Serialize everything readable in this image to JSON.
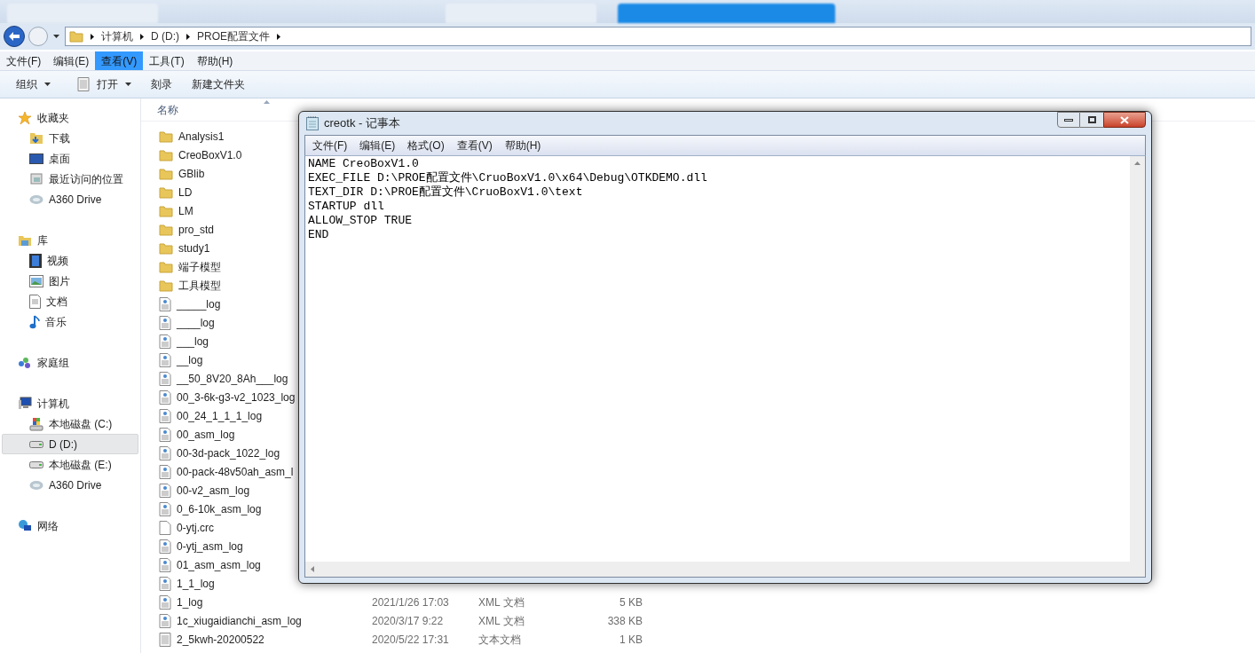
{
  "browser_tabs": [
    {
      "selected": false
    },
    {
      "selected": false
    },
    {
      "selected": true
    }
  ],
  "address_bar": {
    "crumbs": [
      "计算机",
      "D (D:)",
      "PROE配置文件"
    ]
  },
  "menu_bar": [
    {
      "label": "文件(F)",
      "selected": false
    },
    {
      "label": "编辑(E)",
      "selected": false
    },
    {
      "label": "查看(V)",
      "selected": true
    },
    {
      "label": "工具(T)",
      "selected": false
    },
    {
      "label": "帮助(H)",
      "selected": false
    }
  ],
  "toolbar": [
    {
      "label": "组织",
      "kind": "dropdown"
    },
    {
      "label": "打开",
      "kind": "open"
    },
    {
      "label": "刻录",
      "kind": "plain"
    },
    {
      "label": "新建文件夹",
      "kind": "plain"
    }
  ],
  "sidebar": [
    {
      "label": "收藏夹",
      "kind": "star",
      "children": [
        {
          "label": "下载",
          "kind": "download",
          "selected": false
        },
        {
          "label": "桌面",
          "kind": "desktop",
          "selected": false
        },
        {
          "label": "最近访问的位置",
          "kind": "recent",
          "selected": false
        },
        {
          "label": "A360 Drive",
          "kind": "cloud",
          "selected": false
        }
      ]
    },
    {
      "label": "库",
      "kind": "library",
      "children": [
        {
          "label": "视频",
          "kind": "video",
          "selected": false
        },
        {
          "label": "图片",
          "kind": "image",
          "selected": false
        },
        {
          "label": "文档",
          "kind": "doc",
          "selected": false
        },
        {
          "label": "音乐",
          "kind": "music",
          "selected": false
        }
      ]
    },
    {
      "label": "家庭组",
      "kind": "homegroup"
    },
    {
      "label": "计算机",
      "kind": "computer",
      "children": [
        {
          "label": "本地磁盘 (C:)",
          "kind": "sysdrive",
          "selected": false
        },
        {
          "label": "D (D:)",
          "kind": "drive",
          "selected": true
        },
        {
          "label": "本地磁盘 (E:)",
          "kind": "drive",
          "selected": false
        },
        {
          "label": "A360 Drive",
          "kind": "cloud",
          "selected": false
        }
      ]
    },
    {
      "label": "网络",
      "kind": "network"
    }
  ],
  "file_list": {
    "column_header": "名称",
    "files": [
      {
        "name": "Analysis1",
        "kind": "folder"
      },
      {
        "name": "CreoBoxV1.0",
        "kind": "folder"
      },
      {
        "name": "GBlib",
        "kind": "folder"
      },
      {
        "name": "LD",
        "kind": "folder"
      },
      {
        "name": "LM",
        "kind": "folder"
      },
      {
        "name": "pro_std",
        "kind": "folder"
      },
      {
        "name": "study1",
        "kind": "folder"
      },
      {
        "name": "端子模型",
        "kind": "folder"
      },
      {
        "name": "工具模型",
        "kind": "folder"
      },
      {
        "name": "_____log",
        "kind": "xml"
      },
      {
        "name": "____log",
        "kind": "xml"
      },
      {
        "name": "___log",
        "kind": "xml"
      },
      {
        "name": "__log",
        "kind": "xml"
      },
      {
        "name": "__50_8V20_8Ah___log",
        "kind": "xml"
      },
      {
        "name": "00_3-6k-g3-v2_1023_log",
        "kind": "xml"
      },
      {
        "name": "00_24_1_1_1_log",
        "kind": "xml"
      },
      {
        "name": "00_asm_log",
        "kind": "xml"
      },
      {
        "name": "00-3d-pack_1022_log",
        "kind": "xml"
      },
      {
        "name": "00-pack-48v50ah_asm_l",
        "kind": "xml"
      },
      {
        "name": "00-v2_asm_log",
        "kind": "xml"
      },
      {
        "name": "0_6-10k_asm_log",
        "kind": "xml"
      },
      {
        "name": "0-ytj.crc",
        "kind": "blank"
      },
      {
        "name": "0-ytj_asm_log",
        "kind": "xml"
      },
      {
        "name": "01_asm_asm_log",
        "kind": "xml"
      },
      {
        "name": "1_1_log",
        "kind": "xml"
      },
      {
        "name": "1_log",
        "kind": "xml",
        "date": "2021/1/26 17:03",
        "type": "XML 文档",
        "size": "5 KB"
      },
      {
        "name": "1c_xiugaidianchi_asm_log",
        "kind": "xml",
        "date": "2020/3/17 9:22",
        "type": "XML 文档",
        "size": "338 KB"
      },
      {
        "name": "2_5kwh-20200522",
        "kind": "text",
        "date": "2020/5/22 17:31",
        "type": "文本文档",
        "size": "1 KB"
      }
    ]
  },
  "notepad": {
    "title": "creotk - 记事本",
    "menu": [
      "文件(F)",
      "编辑(E)",
      "格式(O)",
      "查看(V)",
      "帮助(H)"
    ],
    "lines": [
      "NAME CreoBoxV1.0",
      "EXEC_FILE D:\\PROE配置文件\\CruoBoxV1.0\\x64\\Debug\\OTKDEMO.dll",
      "TEXT_DIR D:\\PROE配置文件\\CruoBoxV1.0\\text",
      "STARTUP dll",
      "ALLOW_STOP TRUE",
      "END"
    ]
  }
}
